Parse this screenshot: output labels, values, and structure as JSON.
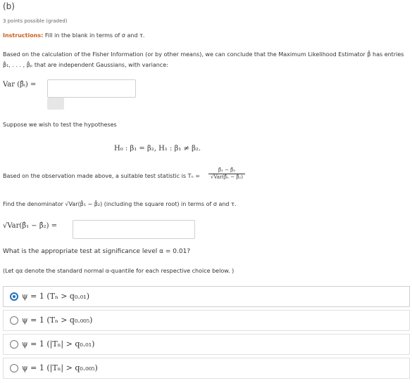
{
  "header": {
    "part": "(b)",
    "points": "3 points possible (graded)",
    "instr_bold": "Instructions:",
    "instr_text": " Fill in the blank in terms of σ and τ."
  },
  "fisher": {
    "line1": "Based on the calculation of the Fisher Information (or by other means), we can conclude that the Maximum Likelihood Estimator β̂ has entries",
    "line2": "β̂₁, . . . , β̂ₚ that are independent Gaussians, with variance:"
  },
  "variance": {
    "label": "Var (β̂ᵢ) =",
    "value": "",
    "placeholder": ""
  },
  "hypotheses": {
    "intro": "Suppose we wish to test the hypotheses",
    "text": "H₀ : β₁ = β₂,      H₁ : β₁ ≠ β₂."
  },
  "teststat": {
    "text": "Based on the observation made above, a suitable test statistic is Tₙ =",
    "num": "β̂₁ − β̂₂",
    "den": "√Var(β̂₁ − β̂₂)"
  },
  "denominator": {
    "question": "Find the denominator √Var(β̂₁ − β̂₂) (including the square root) in terms of σ and τ.",
    "label": "√Var(β̂₁ − β̂₂) =",
    "value": ""
  },
  "test": {
    "question": "What is the appropriate test at significance level α = 0.01?",
    "note": "(Let qα denote the standard normal α-quantile for each respective choice below. )",
    "choices": [
      {
        "label": "ψ = 1 (Tₙ > q₀.₀₁)",
        "selected": true
      },
      {
        "label": "ψ = 1 (Tₙ > q₀.₀₀₅)",
        "selected": false
      },
      {
        "label": "ψ = 1 (|Tₙ| > q₀.₀₁)",
        "selected": false
      },
      {
        "label": "ψ = 1 (|Tₙ| > q₀.₀₀₅)",
        "selected": false
      }
    ]
  }
}
